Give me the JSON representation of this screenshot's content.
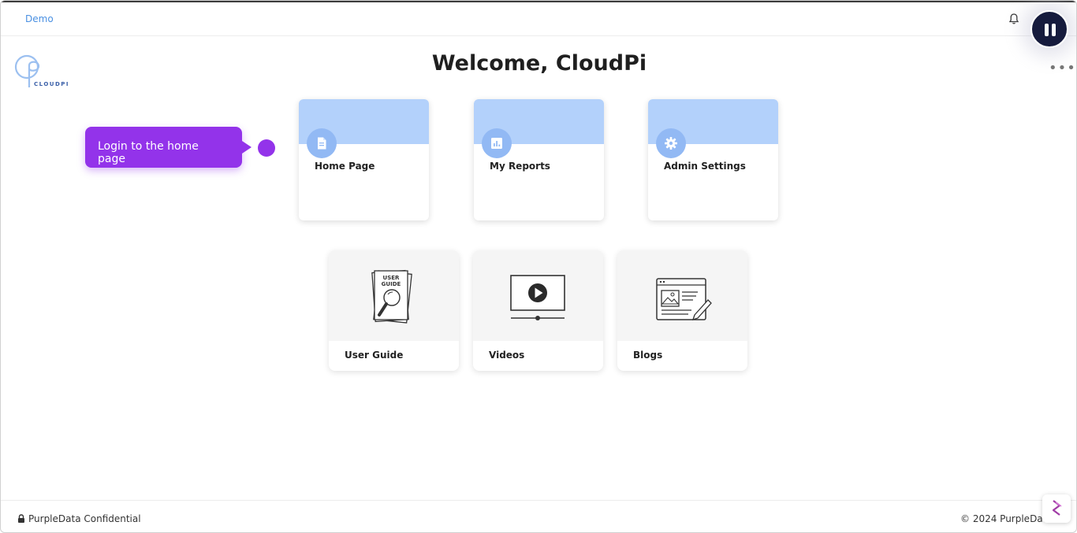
{
  "header": {
    "demo_link": "Demo",
    "icons": {
      "bell": "bell-icon",
      "pause": "pause-icon",
      "more": "more-horizontal-icon"
    }
  },
  "logo": {
    "text": "CLOUDPI"
  },
  "page_title": "Welcome, CloudPi",
  "tooltip": {
    "text": "Login to the home page"
  },
  "cards": [
    {
      "label": "Home Page",
      "icon": "document-icon"
    },
    {
      "label": "My Reports",
      "icon": "report-chart-icon"
    },
    {
      "label": "Admin Settings",
      "icon": "gear-icon"
    }
  ],
  "resources": [
    {
      "label": "User Guide",
      "icon": "user-guide-icon",
      "art_text": [
        "USER",
        "GUIDE"
      ]
    },
    {
      "label": "Videos",
      "icon": "video-play-icon"
    },
    {
      "label": "Blogs",
      "icon": "blog-icon"
    }
  ],
  "footer": {
    "confidential": "PurpleData Confidential",
    "copyright": "© 2024 PurpleData"
  },
  "colors": {
    "accent_purple": "#9333ea",
    "card_band": "#b3d1fb",
    "card_icon_circle": "#92b9f4",
    "link_blue": "#4a90e2",
    "pause_button": "#161b3d"
  }
}
